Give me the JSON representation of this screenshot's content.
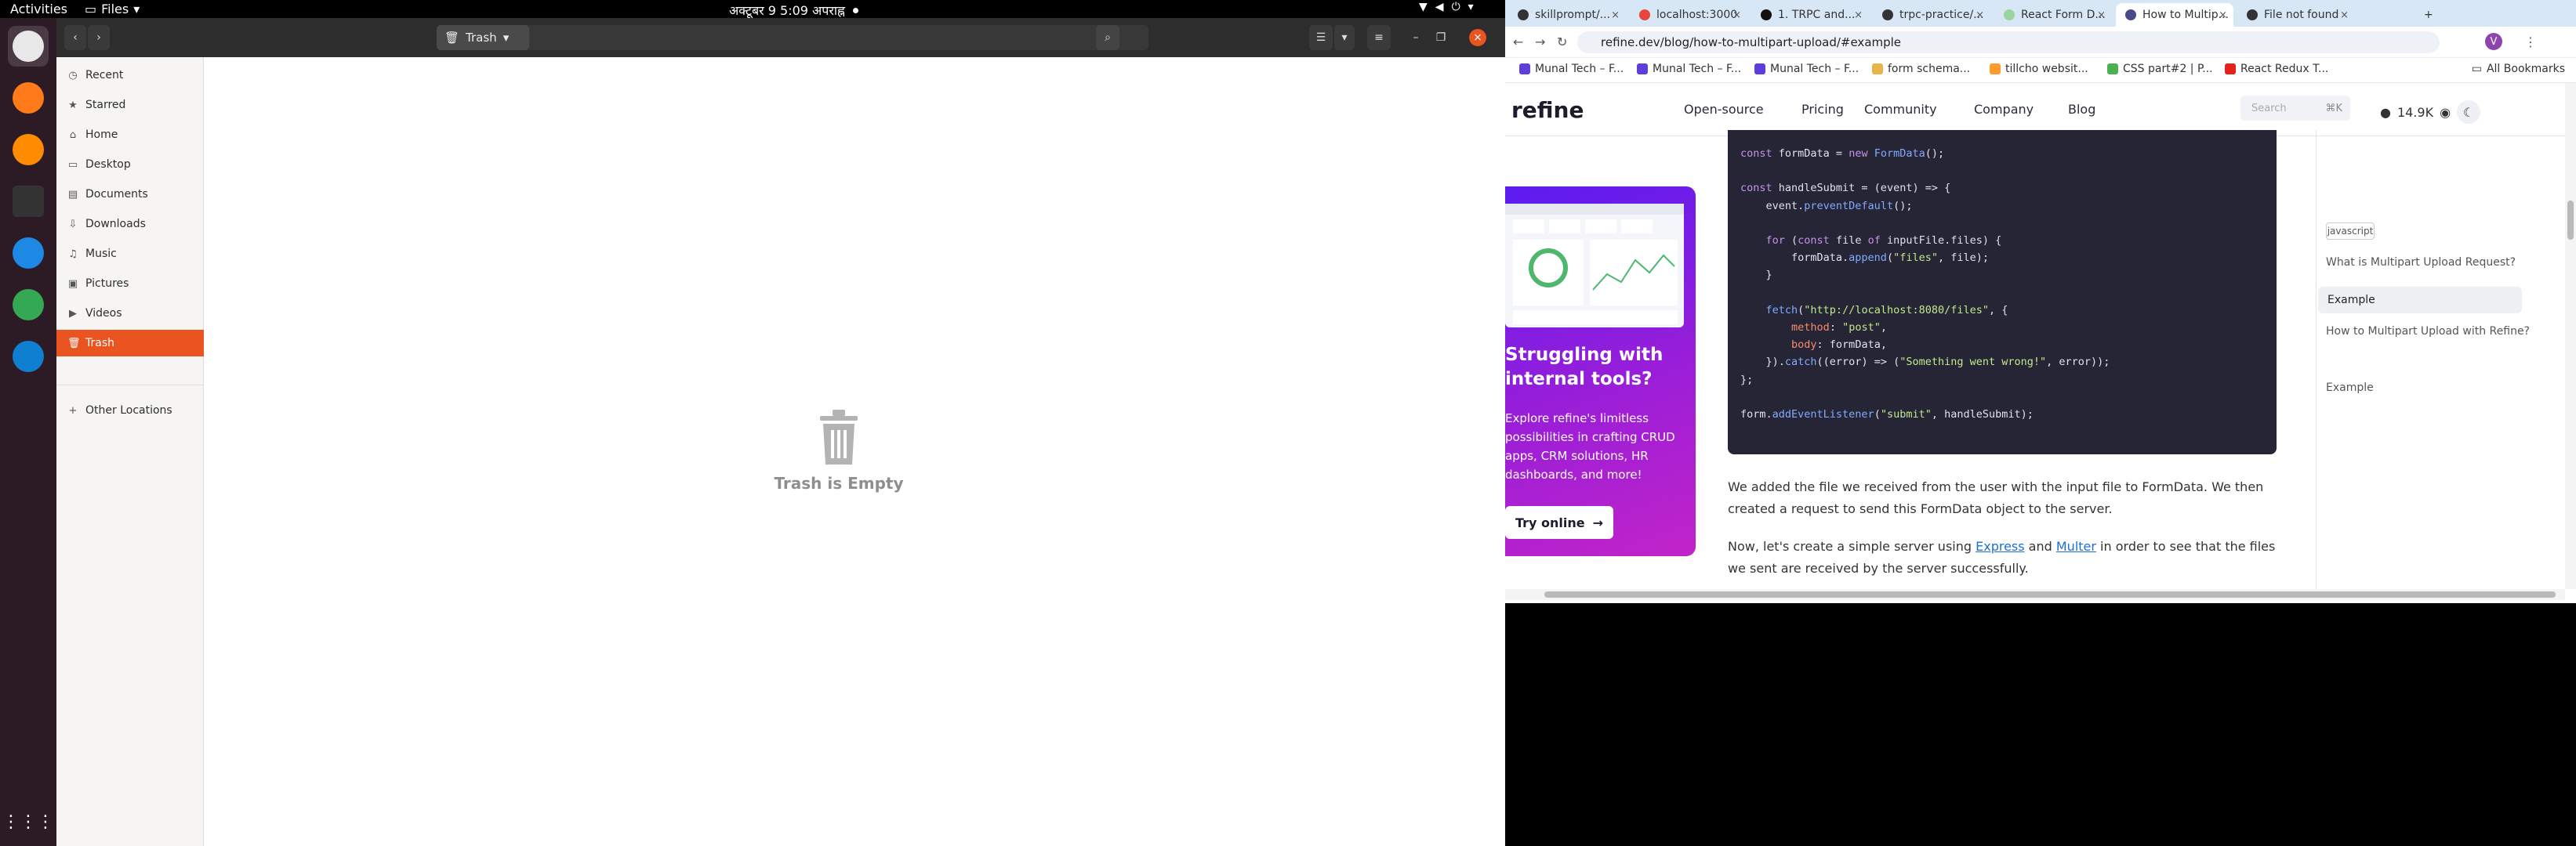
{
  "topbar": {
    "activities": "Activities",
    "app_menu": "Files",
    "datetime": "अक्टूबर 9  5:09 अपराह्न"
  },
  "dock": {
    "apps": [
      {
        "name": "files-icon",
        "color": "#e8e8e8"
      },
      {
        "name": "firefox-icon",
        "color": "#ff7a18"
      },
      {
        "name": "vlc-icon",
        "color": "#ff8c00"
      },
      {
        "name": "terminal-icon",
        "color": "#333333"
      },
      {
        "name": "vscode-icon",
        "color": "#1e88e5"
      },
      {
        "name": "chrome-icon",
        "color": "#34a853"
      },
      {
        "name": "edge-icon",
        "color": "#0f7fd1"
      }
    ]
  },
  "files": {
    "location": "Trash",
    "sidebar": [
      {
        "label": "Recent",
        "icon": "clock-icon"
      },
      {
        "label": "Starred",
        "icon": "star-icon"
      },
      {
        "label": "Home",
        "icon": "home-icon"
      },
      {
        "label": "Desktop",
        "icon": "desktop-icon"
      },
      {
        "label": "Documents",
        "icon": "documents-icon"
      },
      {
        "label": "Downloads",
        "icon": "downloads-icon"
      },
      {
        "label": "Music",
        "icon": "music-icon"
      },
      {
        "label": "Pictures",
        "icon": "pictures-icon"
      },
      {
        "label": "Videos",
        "icon": "videos-icon"
      },
      {
        "label": "Trash",
        "icon": "trash-icon"
      }
    ],
    "other_locations": "Other Locations",
    "empty_message": "Trash is Empty"
  },
  "browser": {
    "tabs": [
      {
        "label": "skillprompt/..."
      },
      {
        "label": "localhost:3000"
      },
      {
        "label": "1. TRPC and..."
      },
      {
        "label": "trpc-practice/..."
      },
      {
        "label": "React Form D..."
      },
      {
        "label": "How to Multip..."
      },
      {
        "label": "File not found"
      }
    ],
    "url": "refine.dev/blog/how-to-multipart-upload/#example",
    "bookmarks": [
      "Munal Tech – F...",
      "Munal Tech – F...",
      "Munal Tech – F...",
      "form schema...",
      "tillcho websit...",
      "CSS part#2 | P...",
      "React Redux T..."
    ],
    "all_bookmarks": "All Bookmarks",
    "profile_initial": "V"
  },
  "site": {
    "logo": "refine",
    "nav": [
      "Open-source",
      "Pricing",
      "Community",
      "Company",
      "Blog"
    ],
    "search_placeholder": "Search",
    "search_kbd": "⌘K",
    "stars": "14.9K",
    "ad": {
      "headline": "Struggling with internal tools?",
      "body": "Explore refine's limitless possibilities in crafting CRUD apps, CRM solutions, HR dashboards, and more!",
      "button": "Try online"
    },
    "code_lines": [
      "const formData = new FormData();",
      "",
      "const handleSubmit = (event) => {",
      "    event.preventDefault();",
      "",
      "    for (const file of inputFile.files) {",
      "        formData.append(\"files\", file);",
      "    }",
      "",
      "    fetch(\"http://localhost:8080/files\", {",
      "        method: \"post\",",
      "        body: formData,",
      "    }).catch((error) => (\"Something went wrong!\", error));",
      "};",
      "",
      "form.addEventListener(\"submit\", handleSubmit);"
    ],
    "para1": "We added the file we received from the user with the input file to FormData. We then created a request to send this FormData object to the server.",
    "para2_a": "Now, let's create a simple server using ",
    "para2_link1": "Express",
    "para2_b": " and ",
    "para2_link2": "Multer",
    "para2_c": " in order to see that the files we sent are received by the server successfully.",
    "toc_tag": "javascript",
    "toc": [
      "What is Multipart Upload Request?",
      "Example",
      "How to Multipart Upload with Refine?",
      "Example"
    ]
  }
}
